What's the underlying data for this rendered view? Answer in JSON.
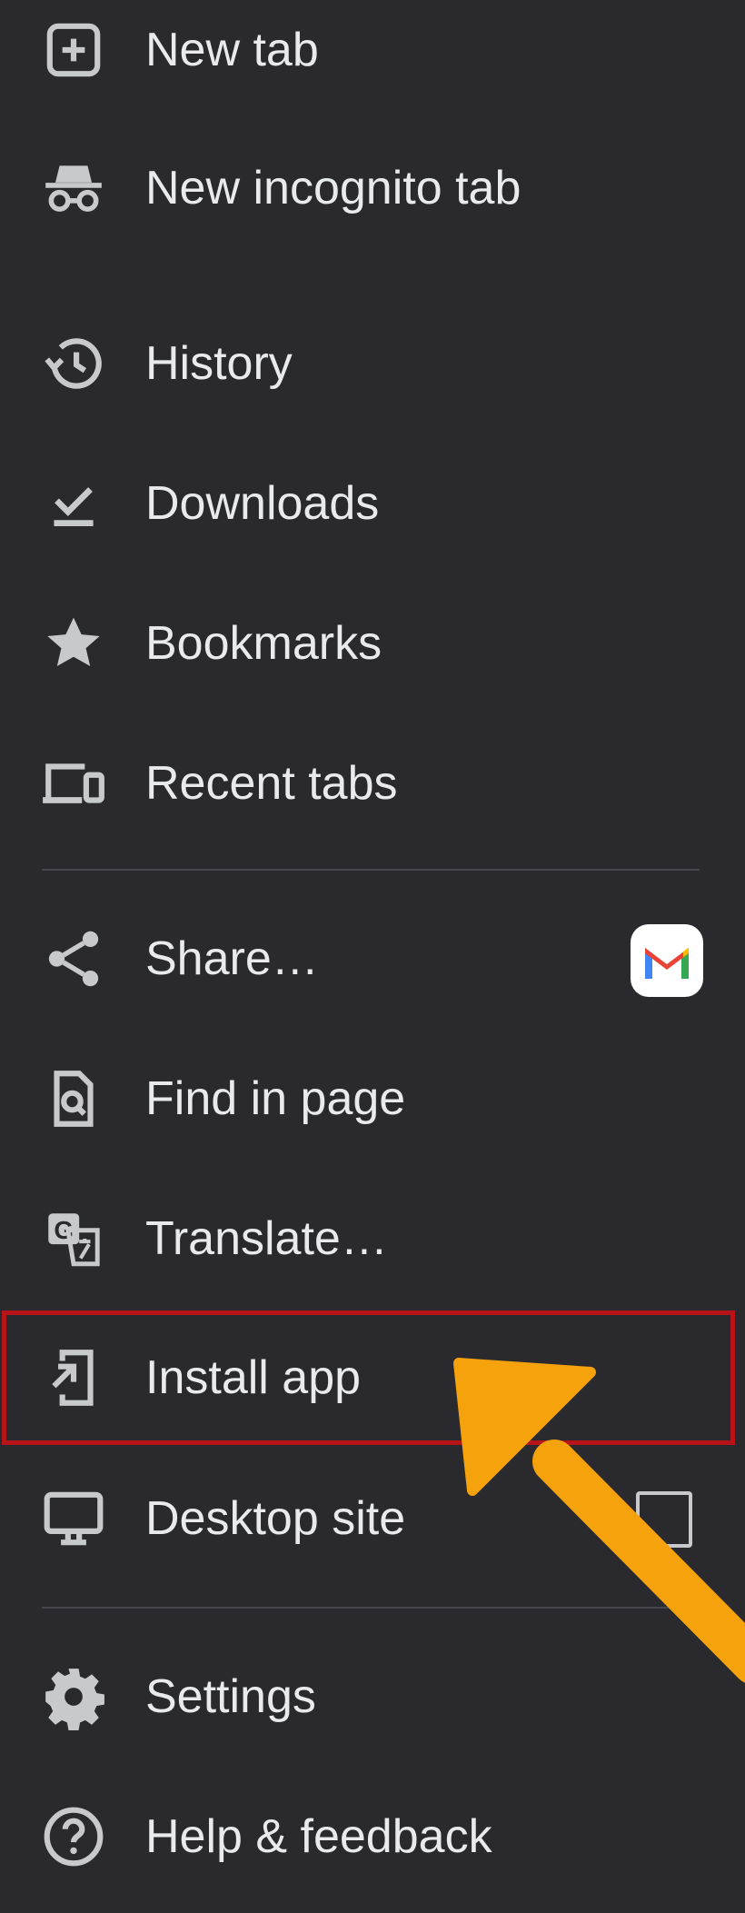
{
  "menu": {
    "items": [
      {
        "label": "New tab",
        "icon": "new-tab-icon"
      },
      {
        "label": "New incognito tab",
        "icon": "incognito-icon"
      },
      {
        "label": "History",
        "icon": "history-icon"
      },
      {
        "label": "Downloads",
        "icon": "downloads-icon"
      },
      {
        "label": "Bookmarks",
        "icon": "star-icon"
      },
      {
        "label": "Recent tabs",
        "icon": "devices-icon"
      },
      {
        "label": "Share…",
        "icon": "share-icon"
      },
      {
        "label": "Find in page",
        "icon": "find-in-page-icon"
      },
      {
        "label": "Translate…",
        "icon": "translate-icon"
      },
      {
        "label": "Install app",
        "icon": "install-app-icon"
      },
      {
        "label": "Desktop site",
        "icon": "desktop-icon"
      },
      {
        "label": "Settings",
        "icon": "gear-icon"
      },
      {
        "label": "Help & feedback",
        "icon": "help-icon"
      }
    ],
    "share_shortcut_icon": "gmail-icon",
    "desktop_site_checked": false,
    "highlighted_item": "Install app"
  },
  "colors": {
    "background": "#2a2a2e",
    "text": "#e8eaed",
    "icon": "#c8c9cc",
    "divider": "#45464b",
    "highlight_border": "#b61418",
    "annotation_arrow": "#f5a20c"
  },
  "annotation": {
    "arrow_icon": "arrow-pointer-icon"
  }
}
